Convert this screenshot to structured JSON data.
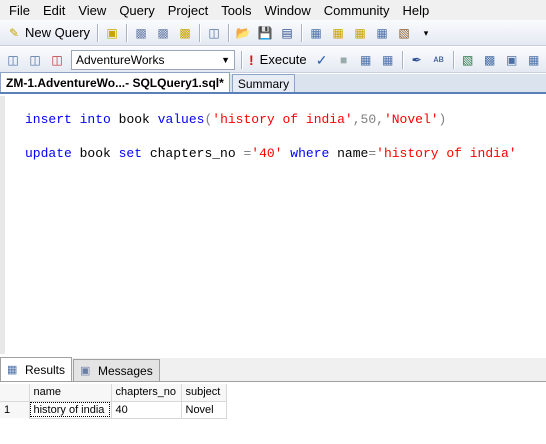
{
  "menu": [
    "File",
    "Edit",
    "View",
    "Query",
    "Project",
    "Tools",
    "Window",
    "Community",
    "Help"
  ],
  "toolbar1": {
    "new_query_label": "New Query"
  },
  "toolbar2": {
    "database": "AdventureWorks",
    "execute_label": "Execute"
  },
  "tabs": [
    {
      "label": "ZM-1.AdventureWo...- SQLQuery1.sql*"
    },
    {
      "label": "Summary"
    }
  ],
  "editor": {
    "line1": {
      "insert": "insert",
      "into": "into",
      "book": " book ",
      "values": "values",
      "open": "(",
      "s1": "'history of india'",
      "comma1": ",50,",
      "s2": "'Novel'",
      "close": ")"
    },
    "line2": {
      "update": "update",
      "book": " book ",
      "set": "set",
      "col": " chapters_no ",
      "eq1": "=",
      "s1": "'40'",
      "where": "where",
      "name": " name",
      "eq2": "=",
      "s2": "'history of india'"
    }
  },
  "results": {
    "tabs": [
      {
        "label": "Results"
      },
      {
        "label": "Messages"
      }
    ],
    "columns": [
      "name",
      "chapters_no",
      "subject"
    ],
    "rows": [
      {
        "num": "1",
        "cells": [
          "history of india",
          "40",
          "Novel"
        ]
      }
    ]
  }
}
